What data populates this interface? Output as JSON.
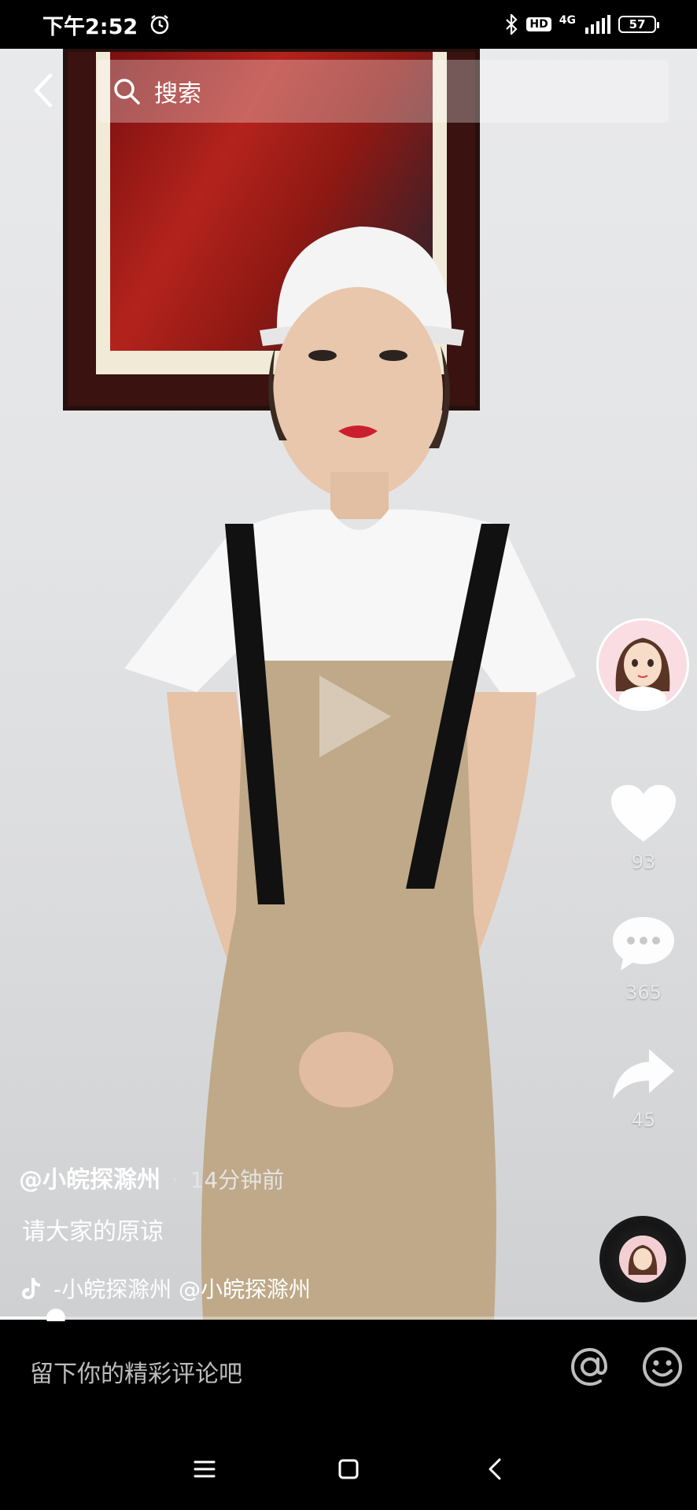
{
  "status_bar": {
    "time": "下午2:52",
    "alarm_icon": "alarm-icon",
    "bluetooth_icon": "bluetooth-icon",
    "hd_badge": "HD",
    "network": "4G",
    "battery": "57"
  },
  "header": {
    "search_placeholder": "搜索"
  },
  "rail": {
    "like_count": "93",
    "comment_count": "365",
    "share_count": "45"
  },
  "caption": {
    "author": "@小皖探滁州",
    "separator": "·",
    "time": "14分钟前",
    "description": "请大家的原谅",
    "music": "-小皖探滁州    @小皖探滁州"
  },
  "progress": {
    "fraction": 0.08
  },
  "comment_bar": {
    "placeholder": "留下你的精彩评论吧"
  },
  "colors": {
    "background": "#000000",
    "text": "#ffffff"
  }
}
